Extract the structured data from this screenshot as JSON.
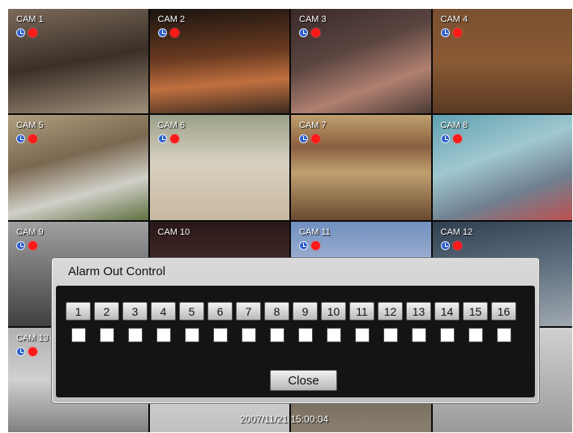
{
  "cameras": [
    {
      "label": "CAM 1"
    },
    {
      "label": "CAM 2"
    },
    {
      "label": "CAM 3"
    },
    {
      "label": "CAM 4"
    },
    {
      "label": "CAM 5"
    },
    {
      "label": "CAM 6"
    },
    {
      "label": "CAM 7"
    },
    {
      "label": "CAM 8"
    },
    {
      "label": "CAM 9"
    },
    {
      "label": "CAM 10"
    },
    {
      "label": "CAM 11"
    },
    {
      "label": "CAM 12"
    },
    {
      "label": "CAM 13"
    },
    {
      "label": ""
    },
    {
      "label": ""
    },
    {
      "label": ""
    }
  ],
  "status_icons": [
    "clock-icon",
    "record-indicator-icon"
  ],
  "timestamp": "2007/11/21 15:00:04",
  "dialog": {
    "title": "Alarm Out Control",
    "alarm_outputs": [
      "1",
      "2",
      "3",
      "4",
      "5",
      "6",
      "7",
      "8",
      "9",
      "10",
      "11",
      "12",
      "13",
      "14",
      "15",
      "16"
    ],
    "checked": [
      false,
      false,
      false,
      false,
      false,
      false,
      false,
      false,
      false,
      false,
      false,
      false,
      false,
      false,
      false,
      false
    ],
    "close_label": "Close"
  },
  "colors": {
    "record_red": "#ff1a1a",
    "clock_blue": "#2e5fd0",
    "dialog_gray": "#c8c8c8",
    "panel_black": "#141414"
  }
}
